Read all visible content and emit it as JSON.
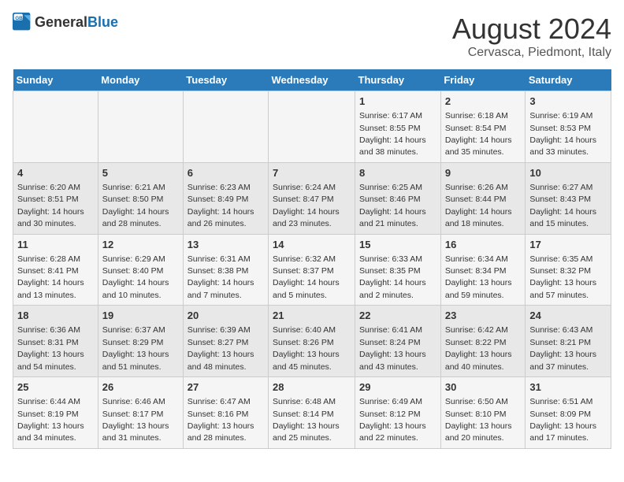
{
  "logo": {
    "general": "General",
    "blue": "Blue"
  },
  "title": "August 2024",
  "subtitle": "Cervasca, Piedmont, Italy",
  "days_of_week": [
    "Sunday",
    "Monday",
    "Tuesday",
    "Wednesday",
    "Thursday",
    "Friday",
    "Saturday"
  ],
  "weeks": [
    [
      {
        "day": "",
        "info": ""
      },
      {
        "day": "",
        "info": ""
      },
      {
        "day": "",
        "info": ""
      },
      {
        "day": "",
        "info": ""
      },
      {
        "day": "1",
        "info": "Sunrise: 6:17 AM\nSunset: 8:55 PM\nDaylight: 14 hours and 38 minutes."
      },
      {
        "day": "2",
        "info": "Sunrise: 6:18 AM\nSunset: 8:54 PM\nDaylight: 14 hours and 35 minutes."
      },
      {
        "day": "3",
        "info": "Sunrise: 6:19 AM\nSunset: 8:53 PM\nDaylight: 14 hours and 33 minutes."
      }
    ],
    [
      {
        "day": "4",
        "info": "Sunrise: 6:20 AM\nSunset: 8:51 PM\nDaylight: 14 hours and 30 minutes."
      },
      {
        "day": "5",
        "info": "Sunrise: 6:21 AM\nSunset: 8:50 PM\nDaylight: 14 hours and 28 minutes."
      },
      {
        "day": "6",
        "info": "Sunrise: 6:23 AM\nSunset: 8:49 PM\nDaylight: 14 hours and 26 minutes."
      },
      {
        "day": "7",
        "info": "Sunrise: 6:24 AM\nSunset: 8:47 PM\nDaylight: 14 hours and 23 minutes."
      },
      {
        "day": "8",
        "info": "Sunrise: 6:25 AM\nSunset: 8:46 PM\nDaylight: 14 hours and 21 minutes."
      },
      {
        "day": "9",
        "info": "Sunrise: 6:26 AM\nSunset: 8:44 PM\nDaylight: 14 hours and 18 minutes."
      },
      {
        "day": "10",
        "info": "Sunrise: 6:27 AM\nSunset: 8:43 PM\nDaylight: 14 hours and 15 minutes."
      }
    ],
    [
      {
        "day": "11",
        "info": "Sunrise: 6:28 AM\nSunset: 8:41 PM\nDaylight: 14 hours and 13 minutes."
      },
      {
        "day": "12",
        "info": "Sunrise: 6:29 AM\nSunset: 8:40 PM\nDaylight: 14 hours and 10 minutes."
      },
      {
        "day": "13",
        "info": "Sunrise: 6:31 AM\nSunset: 8:38 PM\nDaylight: 14 hours and 7 minutes."
      },
      {
        "day": "14",
        "info": "Sunrise: 6:32 AM\nSunset: 8:37 PM\nDaylight: 14 hours and 5 minutes."
      },
      {
        "day": "15",
        "info": "Sunrise: 6:33 AM\nSunset: 8:35 PM\nDaylight: 14 hours and 2 minutes."
      },
      {
        "day": "16",
        "info": "Sunrise: 6:34 AM\nSunset: 8:34 PM\nDaylight: 13 hours and 59 minutes."
      },
      {
        "day": "17",
        "info": "Sunrise: 6:35 AM\nSunset: 8:32 PM\nDaylight: 13 hours and 57 minutes."
      }
    ],
    [
      {
        "day": "18",
        "info": "Sunrise: 6:36 AM\nSunset: 8:31 PM\nDaylight: 13 hours and 54 minutes."
      },
      {
        "day": "19",
        "info": "Sunrise: 6:37 AM\nSunset: 8:29 PM\nDaylight: 13 hours and 51 minutes."
      },
      {
        "day": "20",
        "info": "Sunrise: 6:39 AM\nSunset: 8:27 PM\nDaylight: 13 hours and 48 minutes."
      },
      {
        "day": "21",
        "info": "Sunrise: 6:40 AM\nSunset: 8:26 PM\nDaylight: 13 hours and 45 minutes."
      },
      {
        "day": "22",
        "info": "Sunrise: 6:41 AM\nSunset: 8:24 PM\nDaylight: 13 hours and 43 minutes."
      },
      {
        "day": "23",
        "info": "Sunrise: 6:42 AM\nSunset: 8:22 PM\nDaylight: 13 hours and 40 minutes."
      },
      {
        "day": "24",
        "info": "Sunrise: 6:43 AM\nSunset: 8:21 PM\nDaylight: 13 hours and 37 minutes."
      }
    ],
    [
      {
        "day": "25",
        "info": "Sunrise: 6:44 AM\nSunset: 8:19 PM\nDaylight: 13 hours and 34 minutes."
      },
      {
        "day": "26",
        "info": "Sunrise: 6:46 AM\nSunset: 8:17 PM\nDaylight: 13 hours and 31 minutes."
      },
      {
        "day": "27",
        "info": "Sunrise: 6:47 AM\nSunset: 8:16 PM\nDaylight: 13 hours and 28 minutes."
      },
      {
        "day": "28",
        "info": "Sunrise: 6:48 AM\nSunset: 8:14 PM\nDaylight: 13 hours and 25 minutes."
      },
      {
        "day": "29",
        "info": "Sunrise: 6:49 AM\nSunset: 8:12 PM\nDaylight: 13 hours and 22 minutes."
      },
      {
        "day": "30",
        "info": "Sunrise: 6:50 AM\nSunset: 8:10 PM\nDaylight: 13 hours and 20 minutes."
      },
      {
        "day": "31",
        "info": "Sunrise: 6:51 AM\nSunset: 8:09 PM\nDaylight: 13 hours and 17 minutes."
      }
    ]
  ]
}
